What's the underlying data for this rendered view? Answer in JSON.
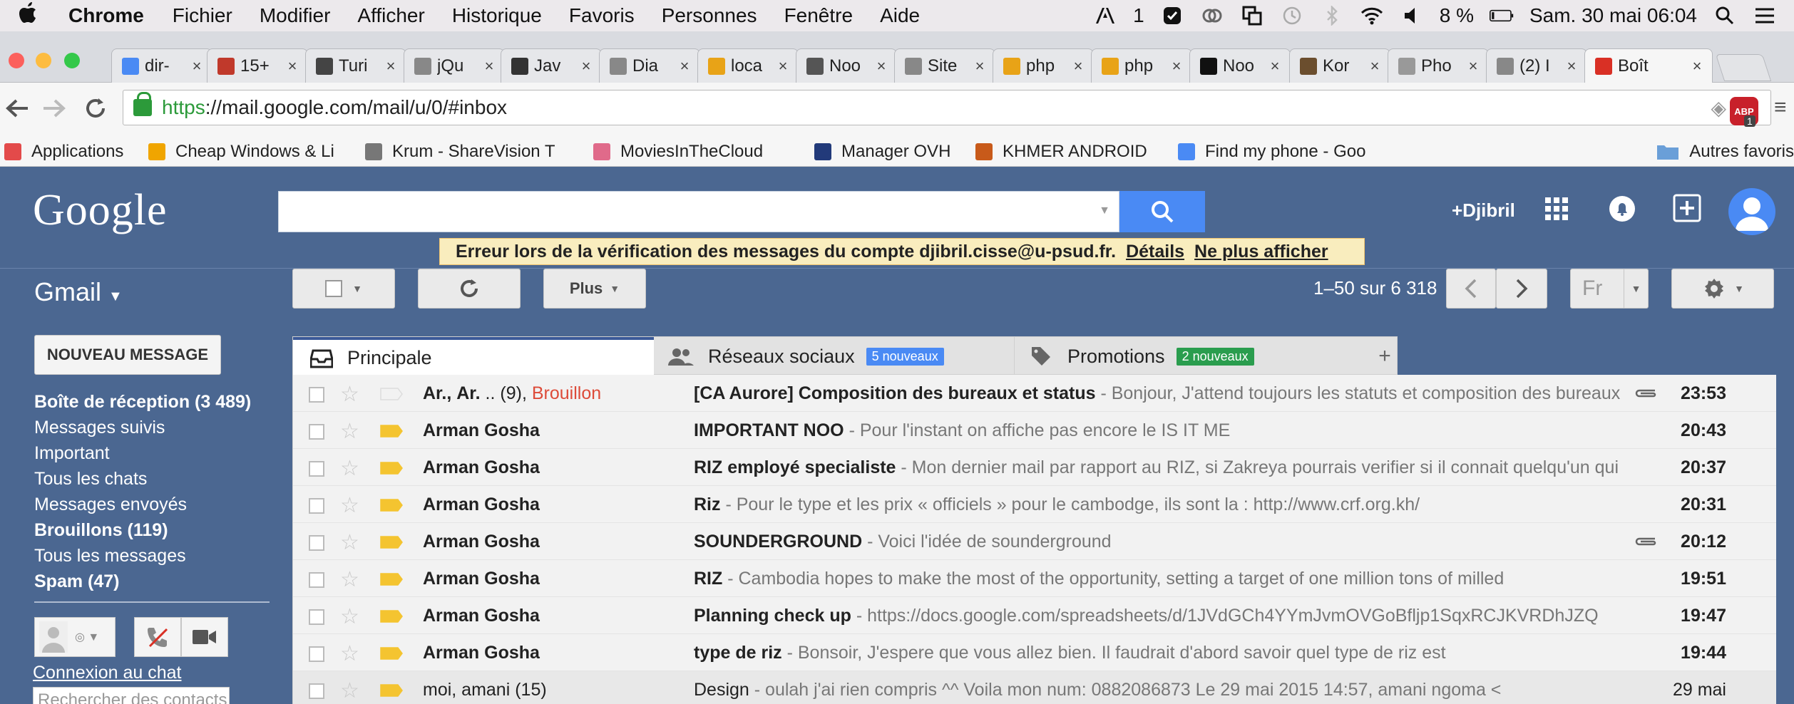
{
  "menubar": {
    "app": "Chrome",
    "items": [
      "Fichier",
      "Modifier",
      "Afficher",
      "Historique",
      "Favoris",
      "Personnes",
      "Fenêtre",
      "Aide"
    ],
    "status": {
      "notif_count": "1",
      "battery": "8 %",
      "datetime": "Sam. 30 mai  06:04"
    }
  },
  "tabs": [
    {
      "title": "dir-",
      "favicon": "google-icon",
      "color": "#4a8af4"
    },
    {
      "title": "15+",
      "favicon": "jr-icon",
      "color": "#c0392b"
    },
    {
      "title": "Turi",
      "favicon": "page-icon",
      "color": "#444444"
    },
    {
      "title": "jQu",
      "favicon": "doc-icon",
      "color": "#888888"
    },
    {
      "title": "Jav",
      "favicon": "java-icon",
      "color": "#333333"
    },
    {
      "title": "Dia",
      "favicon": "doc-icon",
      "color": "#888888"
    },
    {
      "title": "loca",
      "favicon": "pma-icon",
      "color": "#e8a317"
    },
    {
      "title": "Noo",
      "favicon": "noo-icon",
      "color": "#555555"
    },
    {
      "title": "Site",
      "favicon": "doc-icon",
      "color": "#888888"
    },
    {
      "title": "php",
      "favicon": "pma-icon",
      "color": "#e8a317"
    },
    {
      "title": "php",
      "favicon": "pma-icon",
      "color": "#e8a317"
    },
    {
      "title": "Noo",
      "favicon": "hexagon-icon",
      "color": "#111111"
    },
    {
      "title": "Kor",
      "favicon": "cat-icon",
      "color": "#6b4e2e"
    },
    {
      "title": "Pho",
      "favicon": "cloud-icon",
      "color": "#999999"
    },
    {
      "title": "(2) I",
      "favicon": "doc-icon",
      "color": "#888888"
    },
    {
      "title": "Boît",
      "favicon": "gmail-icon",
      "color": "#d93025",
      "active": true
    }
  ],
  "address": {
    "scheme": "https",
    "rest": "://mail.google.com/mail/u/0/#inbox"
  },
  "abp_count": "1",
  "bookmarks": [
    {
      "label": "Applications",
      "icon": "apps-grid-icon"
    },
    {
      "label": "Cheap Windows & Li",
      "icon": "banana-icon"
    },
    {
      "label": "Krum - ShareVision T",
      "icon": "people-icon"
    },
    {
      "label": "MoviesInTheCloud",
      "icon": "balloon-icon"
    },
    {
      "label": "Manager OVH",
      "icon": "ovh-icon"
    },
    {
      "label": "KHMER ANDROID",
      "icon": "hand-icon"
    },
    {
      "label": "Find my phone - Goo",
      "icon": "google-icon"
    }
  ],
  "bookmarks_other": "Autres favoris",
  "gmail": {
    "logo": "Google",
    "user": "+Djibril",
    "product": "Gmail",
    "error": {
      "text": "Erreur lors de la vérification des messages du compte djibril.cisse@u-psud.fr.",
      "details": "Détails",
      "dismiss": "Ne plus afficher"
    },
    "more_label": "Plus",
    "pager": "1–50 sur 6 318",
    "lang": "Fr",
    "compose": "NOUVEAU MESSAGE",
    "nav": [
      {
        "label": "Boîte de réception (3 489)",
        "bold": true
      },
      {
        "label": "Messages suivis",
        "bold": false
      },
      {
        "label": "Important",
        "bold": false
      },
      {
        "label": "Tous les chats",
        "bold": false
      },
      {
        "label": "Messages envoyés",
        "bold": false
      },
      {
        "label": "Brouillons (119)",
        "bold": true
      },
      {
        "label": "Tous les messages",
        "bold": false
      },
      {
        "label": "Spam (47)",
        "bold": true
      }
    ],
    "chat_link": "Connexion au chat",
    "chat_search_placeholder": "Rechercher des contacts",
    "tabs": [
      {
        "label": "Principale",
        "badge": ""
      },
      {
        "label": "Réseaux sociaux",
        "badge": "5 nouveaux",
        "badge_color": "#4a8af4"
      },
      {
        "label": "Promotions",
        "badge": "2 nouveaux",
        "badge_color": "#2a9d4e"
      }
    ],
    "messages": [
      {
        "sender": "Ar., Ar. .. (9),",
        "draft": "Brouillon",
        "subject": "[CA Aurore] Composition des bureaux et status",
        "preview": " - Bonjour, J'attend toujours les statuts et composition des bureaux",
        "time": "23:53",
        "attachment": true,
        "important": false,
        "unread": true
      },
      {
        "sender": "Arman Gosha",
        "draft": "",
        "subject": "IMPORTANT NOO",
        "preview": " - Pour l'instant on affiche pas encore le IS IT ME",
        "time": "20:43",
        "attachment": false,
        "important": true,
        "unread": true
      },
      {
        "sender": "Arman Gosha",
        "draft": "",
        "subject": "RIZ employé specialiste",
        "preview": " - Mon dernier mail par rapport au RIZ, si Zakreya pourrais verifier si il connait quelqu'un qui",
        "time": "20:37",
        "attachment": false,
        "important": true,
        "unread": true
      },
      {
        "sender": "Arman Gosha",
        "draft": "",
        "subject": "Riz",
        "preview": " - Pour le type et les prix « officiels » pour le cambodge, ils sont la : http://www.crf.org.kh/",
        "time": "20:31",
        "attachment": false,
        "important": true,
        "unread": true
      },
      {
        "sender": "Arman Gosha",
        "draft": "",
        "subject": "SOUNDERGROUND",
        "preview": " - Voici l'idée de sounderground",
        "time": "20:12",
        "attachment": true,
        "important": true,
        "unread": true
      },
      {
        "sender": "Arman Gosha",
        "draft": "",
        "subject": "RIZ",
        "preview": " - Cambodia hopes to make the most of the opportunity, setting a target of one million tons of milled",
        "time": "19:51",
        "attachment": false,
        "important": true,
        "unread": true
      },
      {
        "sender": "Arman Gosha",
        "draft": "",
        "subject": "Planning check up",
        "preview": " - https://docs.google.com/spreadsheets/d/1JVdGCh4YYmJvmOVGoBfljp1SqxRCJKVRDhJZQ",
        "time": "19:47",
        "attachment": false,
        "important": true,
        "unread": true
      },
      {
        "sender": "Arman Gosha",
        "draft": "",
        "subject": "type de riz",
        "preview": " - Bonsoir, J'espere que vous allez bien. Il faudrait d'abord savoir quel type de riz est",
        "time": "19:44",
        "attachment": false,
        "important": true,
        "unread": true
      },
      {
        "sender": "moi, amani (15)",
        "draft": "",
        "subject": "Design",
        "preview": " - oulah j'ai rien compris ^^ Voila mon num: 0882086873 Le 29 mai 2015 14:57, amani ngoma <",
        "time": "29 mai",
        "attachment": false,
        "important": true,
        "unread": false
      }
    ]
  },
  "colors": {
    "gmail_header": "#4b6791",
    "accent_blue": "#4a8af4",
    "important_yellow": "#f4c430",
    "draft_red": "#dd4b39"
  }
}
